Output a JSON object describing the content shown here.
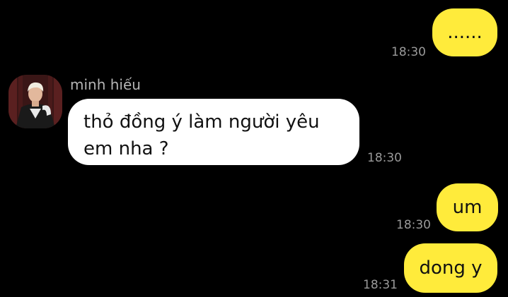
{
  "messages": [
    {
      "direction": "out",
      "text": "......",
      "time": "18:30"
    },
    {
      "direction": "in",
      "sender": "minh hiếu",
      "avatar_icon": "user-avatar-photo",
      "text_line1": "thỏ đồng ý làm người yêu",
      "text_line2": "em nha ?",
      "time": "18:30"
    },
    {
      "direction": "out",
      "text": "um",
      "time": "18:30"
    },
    {
      "direction": "out",
      "text": "dong y",
      "time": "18:31"
    }
  ],
  "colors": {
    "background": "#000000",
    "outgoing_bubble": "#ffeb3b",
    "incoming_bubble": "#ffffff",
    "timestamp": "#9a9a9a",
    "sender_name": "#b4b4b4"
  }
}
